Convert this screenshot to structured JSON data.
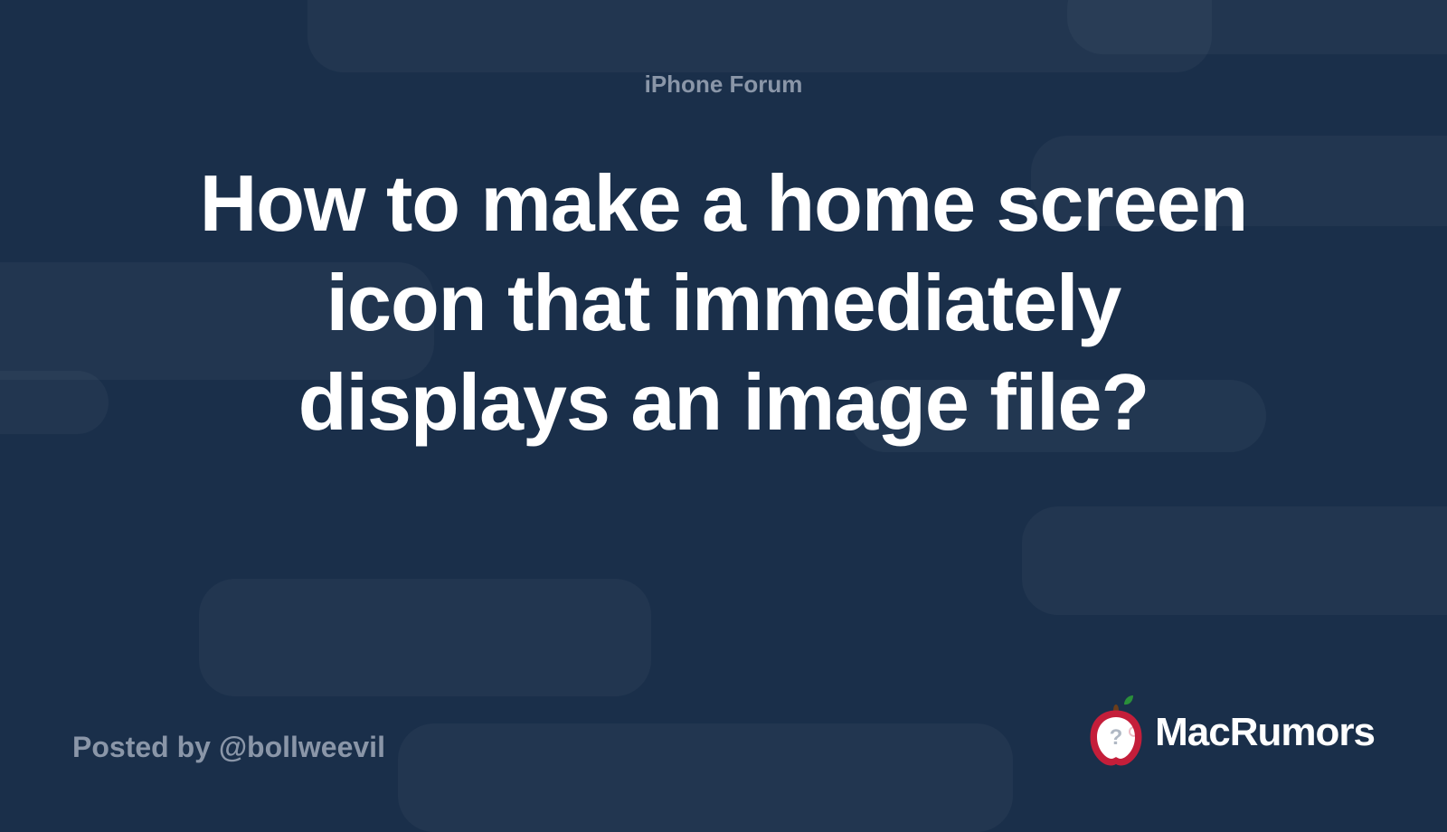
{
  "category": "iPhone Forum",
  "title": "How to make a home screen icon that immediately displays an image file?",
  "posted_by_prefix": "Posted by ",
  "author_handle": "@bollweevil",
  "brand_name": "MacRumors"
}
